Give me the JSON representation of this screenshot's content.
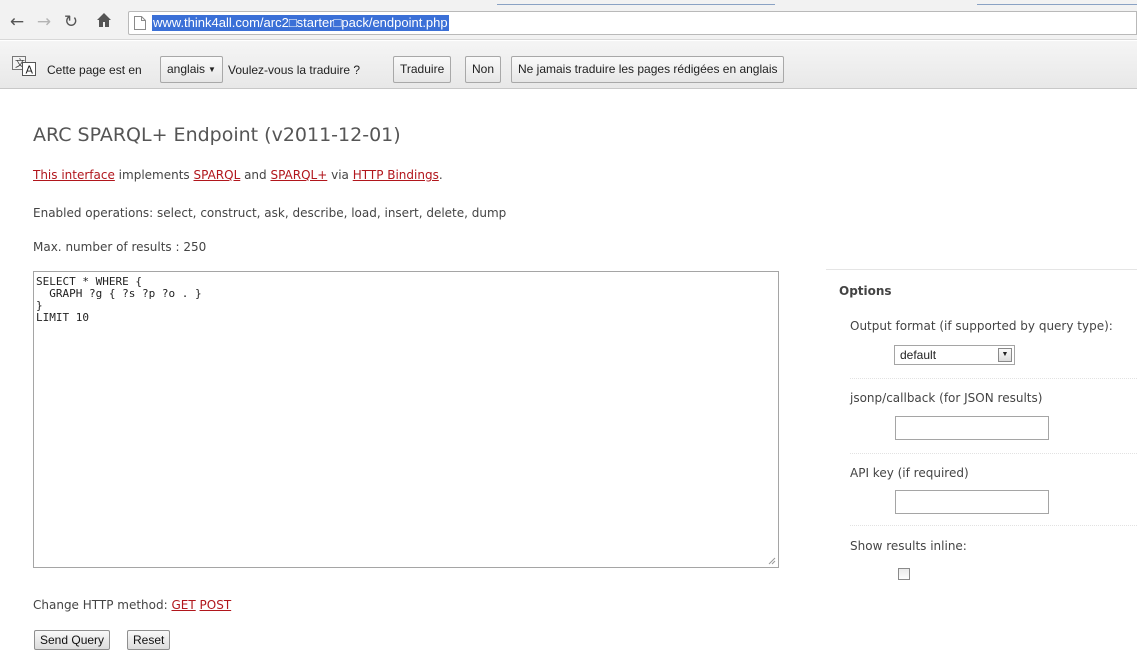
{
  "browser": {
    "url": "www.think4all.com/arc2□starter□pack/endpoint.php",
    "icons": {
      "back": "back-arrow-icon",
      "forward": "forward-arrow-icon",
      "reload": "reload-icon",
      "home": "home-icon",
      "page": "page-icon"
    }
  },
  "translate_bar": {
    "prefix": "Cette page est en",
    "language": "anglais",
    "question": "Voulez-vous la traduire ?",
    "translate_label": "Traduire",
    "no_label": "Non",
    "never_label": "Ne jamais traduire les pages rédigées en anglais"
  },
  "page": {
    "title": "ARC SPARQL+ Endpoint (v2011-12-01)",
    "intro": {
      "link_interface": "This interface",
      "implements": " implements ",
      "link_sparql": "SPARQL",
      "and": " and ",
      "link_sparql_plus": "SPARQL+",
      "via": " via ",
      "link_http_bindings": "HTTP Bindings",
      "end": "."
    },
    "enabled_operations": "Enabled operations: select, construct, ask, describe, load, insert, delete, dump",
    "max_results": "Max. number of results : 250",
    "query": "SELECT * WHERE {\n  GRAPH ?g { ?s ?p ?o . }\n}\nLIMIT 10",
    "http_method": {
      "label": "Change HTTP method: ",
      "get": "GET",
      "post": "POST"
    },
    "send_label": "Send Query",
    "reset_label": "Reset"
  },
  "options": {
    "title": "Options",
    "output_format_label": "Output format (if supported by query type):",
    "output_format_value": "default",
    "jsonp_label": "jsonp/callback (for JSON results)",
    "jsonp_value": "",
    "api_key_label": "API key (if required)",
    "api_key_value": "",
    "inline_label": "Show results inline:",
    "inline_checked": false
  },
  "colors": {
    "link": "#b1161c",
    "url_highlight": "#3b70d7",
    "text": "#444444"
  }
}
